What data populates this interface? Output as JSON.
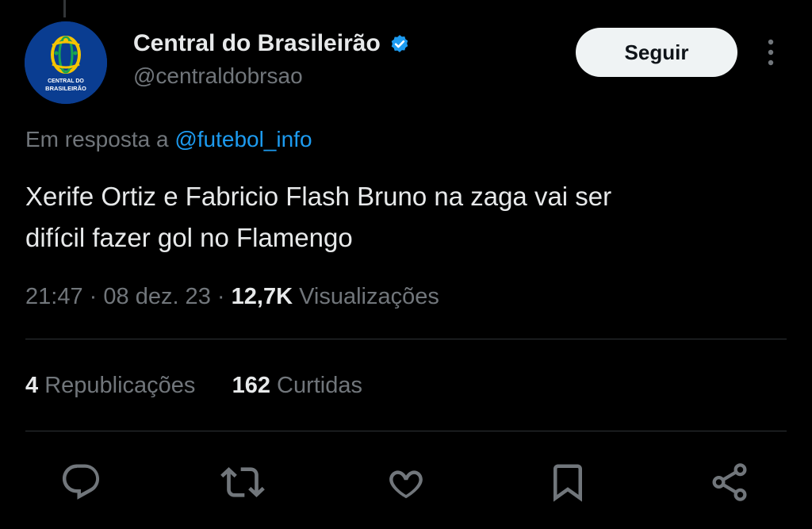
{
  "author": {
    "display_name": "Central do Brasileirão",
    "handle": "@centraldobrsao",
    "avatar_text_line1": "CENTRAL DO",
    "avatar_text_line2": "BRASILEIRÃO",
    "verified": true
  },
  "follow_button": {
    "label": "Seguir"
  },
  "reply_context": {
    "prefix": "Em resposta a",
    "mention": "@futebol_info"
  },
  "tweet": {
    "text_line1": "Xerife Ortiz e Fabricio Flash Bruno na zaga vai ser",
    "text_line2": "difícil fazer gol no Flamengo",
    "time": "21:47",
    "date": "08 dez. 23",
    "separator": "·",
    "views_count": "12,7K",
    "views_label": "Visualizações"
  },
  "stats": {
    "reposts_count": "4",
    "reposts_label": "Republicações",
    "likes_count": "162",
    "likes_label": "Curtidas"
  },
  "icons": {
    "more": "more-vertical-icon",
    "reply": "reply-icon",
    "repost": "repost-icon",
    "like": "heart-icon",
    "bookmark": "bookmark-icon",
    "share": "share-icon",
    "verified": "verified-badge-icon"
  },
  "colors": {
    "background": "#000000",
    "text_primary": "#e7e9ea",
    "text_secondary": "#71767b",
    "link": "#1d9bf0",
    "verified": "#1d9bf0",
    "follow_bg": "#eff3f4",
    "avatar_bg": "#0a3d91",
    "logo_yellow": "#f5c400",
    "logo_green": "#18a550"
  }
}
